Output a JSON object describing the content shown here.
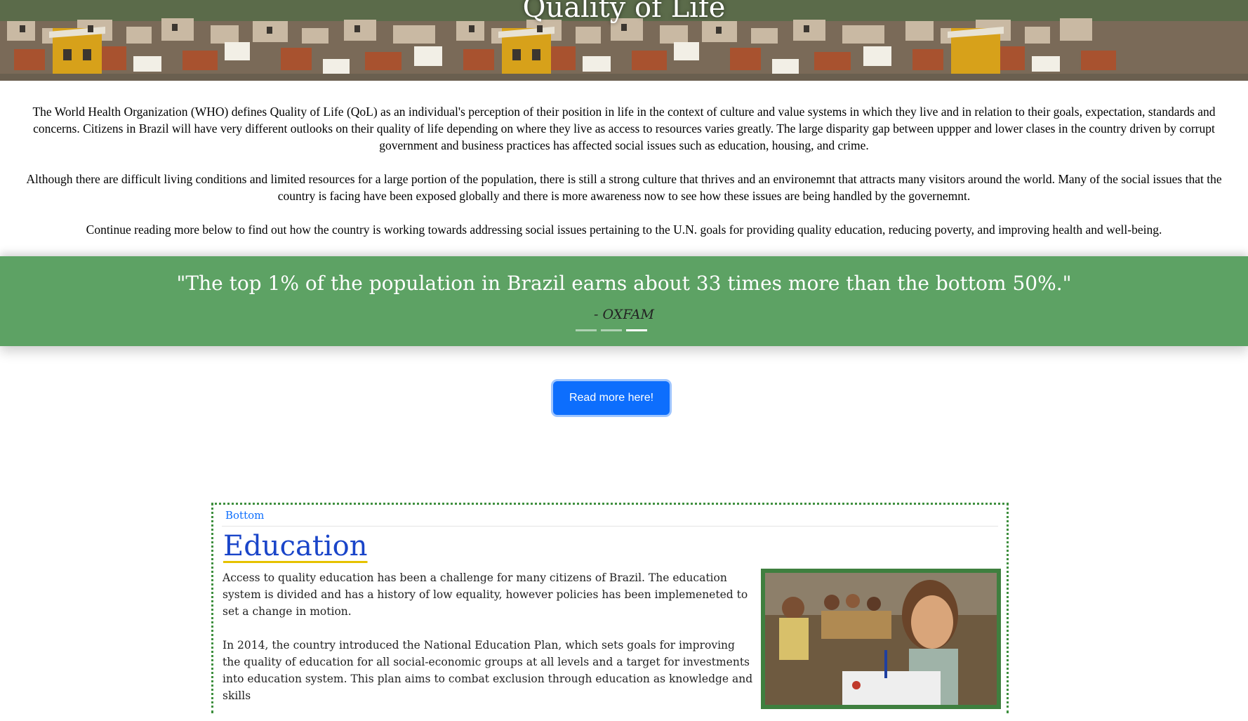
{
  "header": {
    "title": "Quality of Life",
    "banner_image": "favela-hillside-houses"
  },
  "intro": {
    "paragraphs": [
      "The World Health Organization (WHO) defines Quality of Life (QoL) as an individual's perception of their position in life in the context of culture and value systems in which they live and in relation to their goals, expectation, standards and concerns. Citizens in Brazil will have very different outlooks on their quality of life depending on where they live as access to resources varies greatly. The large disparity gap between uppper and lower clases in the country driven by corrupt government and business practices has affected social issues such as education, housing, and crime.",
      "Although there are difficult living conditions and limited resources for a large portion of the population, there is still a strong culture that thrives and an environemnt that attracts many visitors around the world. Many of the social issues that the country is facing have been exposed globally and there is more awareness now to see how these issues are being handled by the governemnt.",
      "Continue reading more below to find out how the country is working towards addressing social issues pertaining to the U.N. goals for providing quality education, reducing poverty, and improving health and well-being."
    ]
  },
  "quote_carousel": {
    "quote": "\"The top 1% of the population in Brazil earns about 33 times more than the bottom 50%.\"",
    "author": "- OXFAM",
    "slide_count": 3,
    "active_slide": 3,
    "background_color": "#5da264"
  },
  "cta": {
    "label": "Read more here!",
    "color": "#0d6efd"
  },
  "education": {
    "bottom_link": "Bottom",
    "title": "Education",
    "paragraphs": [
      "Access to quality education has been a challenge for many citizens of Brazil. The education system is divided and has a history of low equality, however policies has been implemeneted to set a change in motion.",
      "In 2014, the country introduced the National Education Plan, which sets goals for improving the quality of education for all social-economic groups at all levels and a target for investments into education system. This plan aims to combat exclusion through education as knowledge and skills"
    ],
    "photo": "classroom-children-photo",
    "border_color": "#3e8f3e"
  }
}
